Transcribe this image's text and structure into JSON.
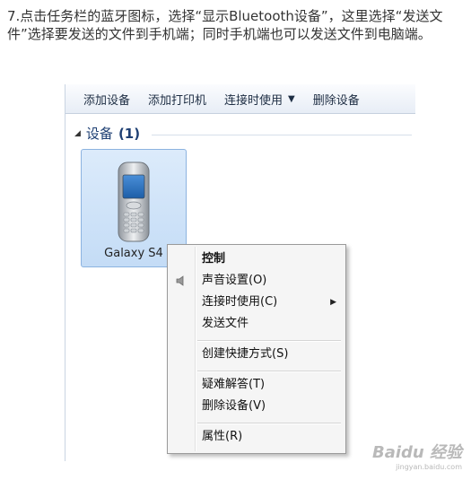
{
  "instruction": "7.点击任务栏的蓝牙图标，选择“显示Bluetooth设备”，这里选择“发送文件”选择要发送的文件到手机端；同时手机端也可以发送文件到电脑端。",
  "toolbar": {
    "add_device": "添加设备",
    "add_printer": "添加打印机",
    "connect_using": "连接时使用",
    "remove_device": "删除设备"
  },
  "group": {
    "title": "设备",
    "count": "(1)"
  },
  "device": {
    "name": "Galaxy S4"
  },
  "context_menu": {
    "items": [
      "控制",
      "声音设置(O)",
      "连接时使用(C)",
      "发送文件",
      "创建快捷方式(S)",
      "疑难解答(T)",
      "删除设备(V)",
      "属性(R)"
    ]
  },
  "watermark": {
    "main": "Baidu 经验",
    "sub": "jingyan.baidu.com"
  }
}
